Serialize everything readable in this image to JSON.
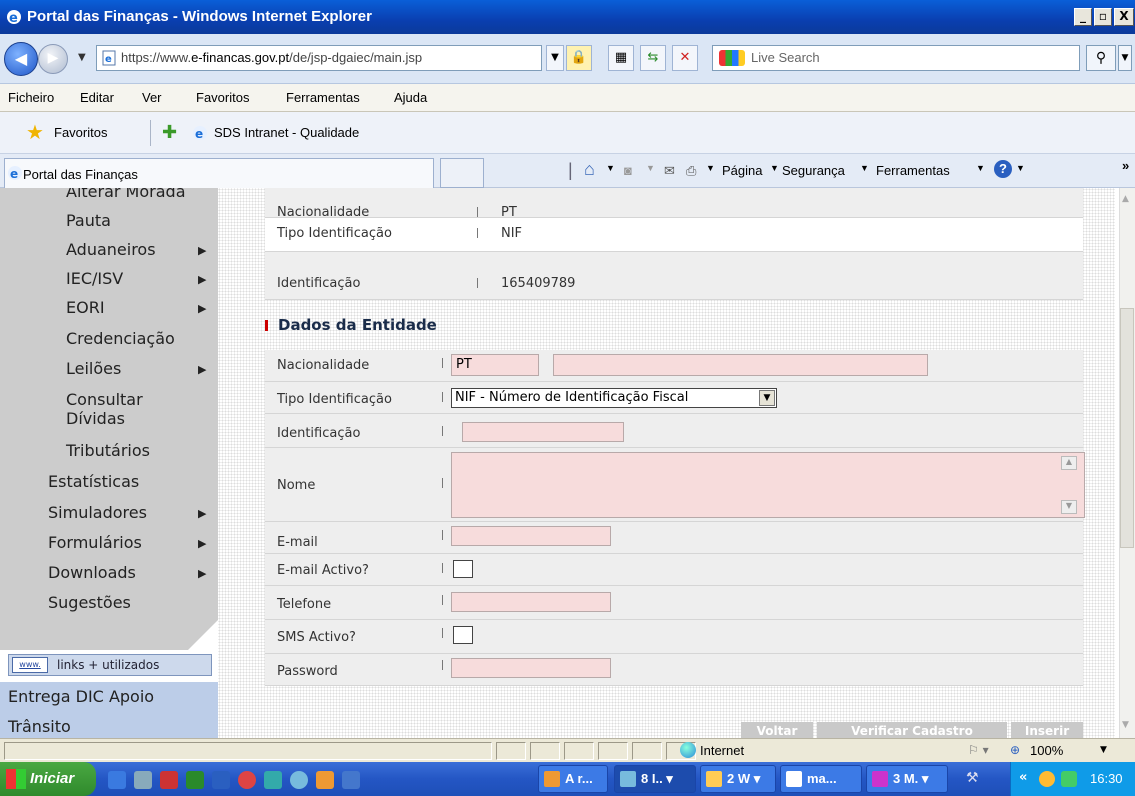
{
  "window": {
    "title": "Portal das Finanças - Windows Internet Explorer"
  },
  "address": {
    "url_prefix": "https://www.",
    "url_domain": "e-financas.gov.pt",
    "url_path": "/de/jsp-dgaiec/main.jsp",
    "search_placeholder": "Live Search"
  },
  "menu": [
    "Ficheiro",
    "Editar",
    "Ver",
    "Favoritos",
    "Ferramentas",
    "Ajuda"
  ],
  "favorites": {
    "label": "Favoritos",
    "link": "SDS Intranet - Qualidade"
  },
  "tab": {
    "label": "Portal das Finanças"
  },
  "commands": {
    "pagina": "Página",
    "seguranca": "Segurança",
    "ferramentas": "Ferramentas"
  },
  "nav": {
    "cut_item": "Alterar Morada",
    "items": [
      {
        "label": "Pauta",
        "arrow": false
      },
      {
        "label": "Aduaneiros",
        "arrow": true
      },
      {
        "label": "IEC/ISV",
        "arrow": true
      },
      {
        "label": "EORI",
        "arrow": true
      },
      {
        "label": "Credenciação",
        "arrow": false
      },
      {
        "label": "Leilões",
        "arrow": true
      },
      {
        "label": "Consultar",
        "arrow": false
      },
      {
        "label": "Dívidas",
        "arrow": false
      },
      {
        "label": "Tributários",
        "arrow": false
      }
    ],
    "items_l2": [
      {
        "label": "Estatísticas",
        "arrow": false
      },
      {
        "label": "Simuladores",
        "arrow": true
      },
      {
        "label": "Formulários",
        "arrow": true
      },
      {
        "label": "Downloads",
        "arrow": true
      },
      {
        "label": "Sugestões",
        "arrow": false
      }
    ],
    "links_bar": {
      "icon_text": "www.",
      "label": "links + utilizados"
    },
    "blue_links": [
      "Entrega DIC Apoio",
      "Trânsito"
    ]
  },
  "top_info": [
    {
      "label": "Nacionalidade",
      "value": "PT"
    },
    {
      "label": "Tipo Identificação",
      "value": "NIF"
    },
    {
      "label": "Identificação",
      "value": "165409789"
    }
  ],
  "section_title": "Dados da Entidade",
  "form": {
    "nacionalidade_label": "Nacionalidade",
    "nacionalidade_value": "PT",
    "nacionalidade_desc": "",
    "tipo_label": "Tipo Identificação",
    "tipo_value": "NIF - Número de Identificação Fiscal",
    "identificacao_label": "Identificação",
    "identificacao_value": "",
    "nome_label": "Nome",
    "nome_value": "",
    "email_label": "E-mail",
    "email_value": "",
    "email_activo_label": "E-mail Activo?",
    "email_activo_checked": false,
    "telefone_label": "Telefone",
    "telefone_value": "",
    "sms_activo_label": "SMS Activo?",
    "sms_activo_checked": false,
    "password_label": "Password",
    "password_value": ""
  },
  "buttons": {
    "voltar": "Voltar",
    "verificar": "Verificar Cadastro",
    "inserir": "Inserir"
  },
  "status": {
    "zone": "Internet",
    "zoom": "100%"
  },
  "taskbar": {
    "start": "Iniciar",
    "tasks": [
      "A r...",
      "8 I..",
      "2 W",
      "ma...",
      "3 M."
    ],
    "clock": "16:30"
  }
}
